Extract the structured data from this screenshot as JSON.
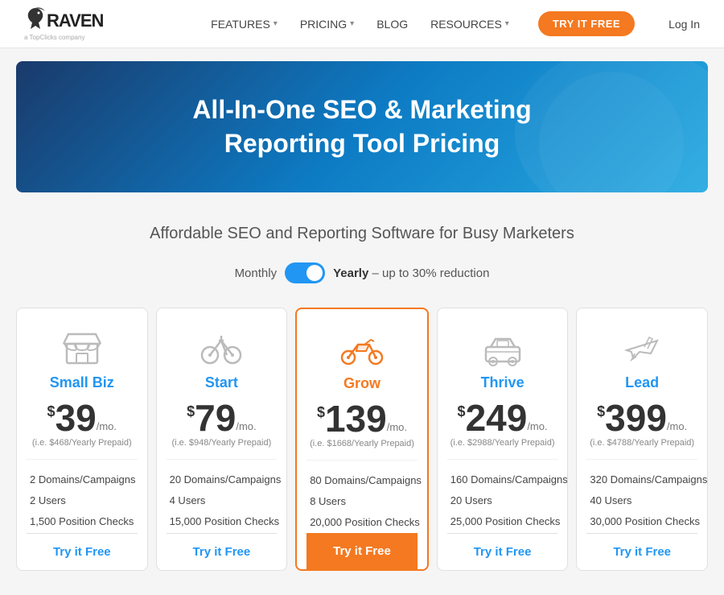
{
  "nav": {
    "logo_text": "RAVEN",
    "logo_sub": "a TopClicks company",
    "links": [
      {
        "label": "FEATURES",
        "has_dropdown": true
      },
      {
        "label": "PRICING",
        "has_dropdown": true
      },
      {
        "label": "BLOG",
        "has_dropdown": false
      },
      {
        "label": "RESOURCES",
        "has_dropdown": true
      }
    ],
    "cta_label": "TRY IT FREE",
    "login_label": "Log In"
  },
  "hero": {
    "title_line1": "All-In-One SEO & Marketing",
    "title_line2": "Reporting Tool Pricing"
  },
  "subtitle": "Affordable SEO and Reporting Software for Busy Marketers",
  "toggle": {
    "monthly_label": "Monthly",
    "yearly_label": "Yearly",
    "yearly_note": "– up to 30% reduction"
  },
  "plans": [
    {
      "id": "small-biz",
      "name": "Small Biz",
      "icon": "store",
      "featured": false,
      "price": "39",
      "period": "/mo.",
      "yearly_note": "(i.e. $468/Yearly Prepaid)",
      "features": [
        "2 Domains/Campaigns",
        "2 Users",
        "1,500 Position Checks"
      ],
      "cta": "Try it Free"
    },
    {
      "id": "start",
      "name": "Start",
      "icon": "bicycle",
      "featured": false,
      "price": "79",
      "period": "/mo.",
      "yearly_note": "(i.e. $948/Yearly Prepaid)",
      "features": [
        "20 Domains/Campaigns",
        "4 Users",
        "15,000 Position Checks"
      ],
      "cta": "Try it Free"
    },
    {
      "id": "grow",
      "name": "Grow",
      "icon": "motorcycle",
      "featured": true,
      "price": "139",
      "period": "/mo.",
      "yearly_note": "(i.e. $1668/Yearly Prepaid)",
      "features": [
        "80 Domains/Campaigns",
        "8 Users",
        "20,000 Position Checks"
      ],
      "cta": "Try it Free"
    },
    {
      "id": "thrive",
      "name": "Thrive",
      "icon": "car",
      "featured": false,
      "price": "249",
      "period": "/mo.",
      "yearly_note": "(i.e. $2988/Yearly Prepaid)",
      "features": [
        "160 Domains/Campaigns",
        "20 Users",
        "25,000 Position Checks"
      ],
      "cta": "Try it Free"
    },
    {
      "id": "lead",
      "name": "Lead",
      "icon": "airplane",
      "featured": false,
      "price": "399",
      "period": "/mo.",
      "yearly_note": "(i.e. $4788/Yearly Prepaid)",
      "features": [
        "320 Domains/Campaigns",
        "40 Users",
        "30,000 Position Checks"
      ],
      "cta": "Try it Free"
    }
  ]
}
